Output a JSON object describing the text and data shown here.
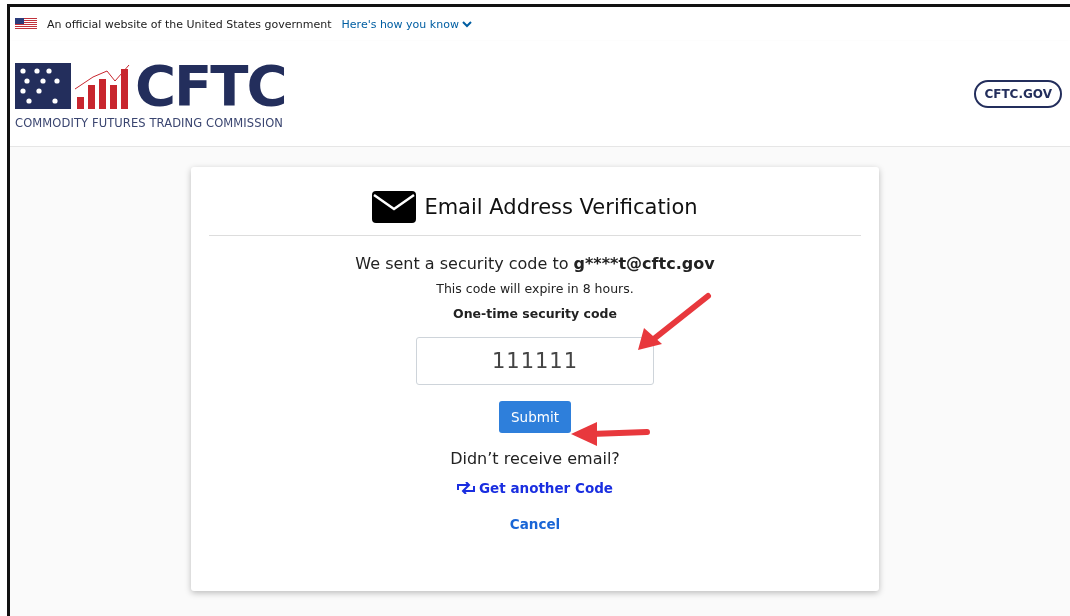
{
  "gov_banner": {
    "text": "An official website of the United States government",
    "link": "Here's how you know"
  },
  "header": {
    "logo_text": "CFTC",
    "logo_subtitle": "COMMODITY FUTURES TRADING COMMISSION",
    "site_button": "CFTC.GOV"
  },
  "card": {
    "title": "Email Address Verification",
    "sent_prefix": "We sent a security code to ",
    "sent_email": "g****t@cftc.gov",
    "expiry": "This code will expire in 8 hours.",
    "code_label": "One-time security code",
    "code_value": "111111",
    "submit": "Submit",
    "resend_question": "Didn’t receive email?",
    "resend_link": "Get another Code",
    "cancel": "Cancel"
  }
}
